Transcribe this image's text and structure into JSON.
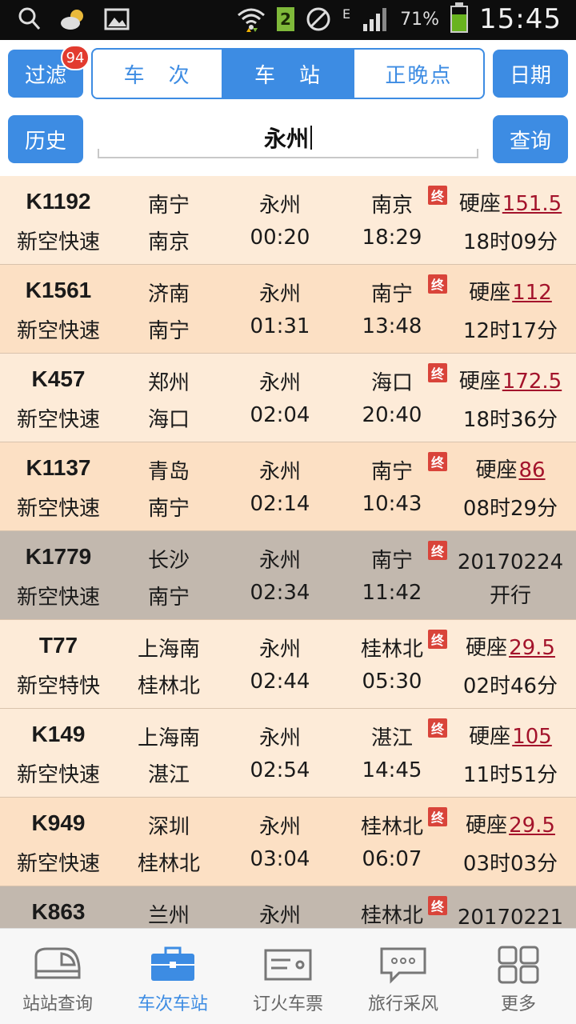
{
  "statusbar": {
    "sim": "2",
    "network": "E",
    "battery_text": "71%",
    "battery_level": 0.71,
    "time": "15:45"
  },
  "toolbar": {
    "filter_label": "过滤",
    "filter_badge": "94",
    "tabs": [
      {
        "label": "车　次",
        "active": false
      },
      {
        "label": "车　站",
        "active": true
      },
      {
        "label": "正晚点",
        "active": false
      }
    ],
    "date_label": "日期",
    "history_label": "历史",
    "search_value": "永州",
    "query_label": "查询"
  },
  "terminus_badge": "终",
  "rows": [
    {
      "train": "K1192",
      "type": "新空快速",
      "from": "南宁",
      "dep": "南京",
      "station": "永州",
      "dtime": "00:20",
      "end": "南京",
      "atime": "18:29",
      "seat": "硬座",
      "price": "151.5",
      "duration": "18时09分",
      "style": "light"
    },
    {
      "train": "K1561",
      "type": "新空快速",
      "from": "济南",
      "dep": "南宁",
      "station": "永州",
      "dtime": "01:31",
      "end": "南宁",
      "atime": "13:48",
      "seat": "硬座",
      "price": "112",
      "duration": "12时17分",
      "style": "dark"
    },
    {
      "train": "K457",
      "type": "新空快速",
      "from": "郑州",
      "dep": "海口",
      "station": "永州",
      "dtime": "02:04",
      "end": "海口",
      "atime": "20:40",
      "seat": "硬座",
      "price": "172.5",
      "duration": "18时36分",
      "style": "light"
    },
    {
      "train": "K1137",
      "type": "新空快速",
      "from": "青岛",
      "dep": "南宁",
      "station": "永州",
      "dtime": "02:14",
      "end": "南宁",
      "atime": "10:43",
      "seat": "硬座",
      "price": "86",
      "duration": "08时29分",
      "style": "dark"
    },
    {
      "train": "K1779",
      "type": "新空快速",
      "from": "长沙",
      "dep": "南宁",
      "station": "永州",
      "dtime": "02:34",
      "end": "南宁",
      "atime": "11:42",
      "note1": "20170224",
      "note2": "开行",
      "style": "disabled"
    },
    {
      "train": "T77",
      "type": "新空特快",
      "from": "上海南",
      "dep": "桂林北",
      "station": "永州",
      "dtime": "02:44",
      "end": "桂林北",
      "atime": "05:30",
      "seat": "硬座",
      "price": "29.5",
      "duration": "02时46分",
      "style": "light"
    },
    {
      "train": "K149",
      "type": "新空快速",
      "from": "上海南",
      "dep": "湛江",
      "station": "永州",
      "dtime": "02:54",
      "end": "湛江",
      "atime": "14:45",
      "seat": "硬座",
      "price": "105",
      "duration": "11时51分",
      "style": "light"
    },
    {
      "train": "K949",
      "type": "新空快速",
      "from": "深圳",
      "dep": "桂林北",
      "station": "永州",
      "dtime": "03:04",
      "end": "桂林北",
      "atime": "06:07",
      "seat": "硬座",
      "price": "29.5",
      "duration": "03时03分",
      "style": "dark"
    },
    {
      "train": "K863",
      "type": "",
      "from": "兰州",
      "dep": "",
      "station": "永州",
      "dtime": "",
      "end": "桂林北",
      "atime": "",
      "note1": "20170221",
      "note2": "",
      "style": "disabled"
    }
  ],
  "bottomnav": [
    {
      "label": "站站查询",
      "icon": "train-icon",
      "active": false
    },
    {
      "label": "车次车站",
      "icon": "briefcase-icon",
      "active": true
    },
    {
      "label": "订火车票",
      "icon": "ticket-icon",
      "active": false
    },
    {
      "label": "旅行采风",
      "icon": "chat-bubble-icon",
      "active": false
    },
    {
      "label": "更多",
      "icon": "grid-icon",
      "active": false
    }
  ]
}
